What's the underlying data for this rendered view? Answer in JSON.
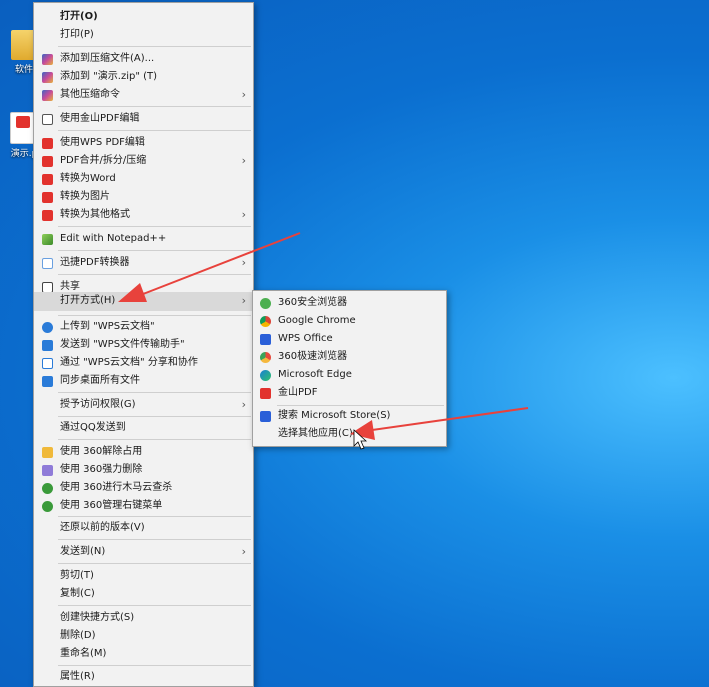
{
  "desktop": {
    "icons": [
      {
        "label": "软件"
      },
      {
        "label": "演示.p"
      }
    ]
  },
  "context_menu": {
    "items": [
      {
        "label": "打开(O)"
      },
      {
        "label": "打印(P)"
      },
      {
        "label": "添加到压缩文件(A)..."
      },
      {
        "label": "添加到 \"演示.zip\" (T)"
      },
      {
        "label": "其他压缩命令"
      },
      {
        "label": "使用金山PDF编辑"
      },
      {
        "label": "使用WPS PDF编辑"
      },
      {
        "label": "PDF合并/拆分/压缩"
      },
      {
        "label": "转换为Word"
      },
      {
        "label": "转换为图片"
      },
      {
        "label": "转换为其他格式"
      },
      {
        "label": "Edit with Notepad++"
      },
      {
        "label": "迅捷PDF转换器"
      },
      {
        "label": "共享"
      },
      {
        "label": "打开方式(H)"
      },
      {
        "label": "上传到 \"WPS云文档\""
      },
      {
        "label": "发送到 \"WPS文件传输助手\""
      },
      {
        "label": "通过 \"WPS云文档\" 分享和协作"
      },
      {
        "label": "同步桌面所有文件"
      },
      {
        "label": "授予访问权限(G)"
      },
      {
        "label": "通过QQ发送到"
      },
      {
        "label": "使用 360解除占用"
      },
      {
        "label": "使用 360强力删除"
      },
      {
        "label": "使用 360进行木马云查杀"
      },
      {
        "label": "使用 360管理右键菜单"
      },
      {
        "label": "还原以前的版本(V)"
      },
      {
        "label": "发送到(N)"
      },
      {
        "label": "剪切(T)"
      },
      {
        "label": "复制(C)"
      },
      {
        "label": "创建快捷方式(S)"
      },
      {
        "label": "删除(D)"
      },
      {
        "label": "重命名(M)"
      },
      {
        "label": "属性(R)"
      }
    ]
  },
  "open_with_submenu": {
    "items": [
      {
        "label": "360安全浏览器"
      },
      {
        "label": "Google Chrome"
      },
      {
        "label": "WPS Office"
      },
      {
        "label": "360极速浏览器"
      },
      {
        "label": "Microsoft Edge"
      },
      {
        "label": "金山PDF"
      },
      {
        "label": "搜索 Microsoft Store(S)"
      },
      {
        "label": "选择其他应用(C)"
      }
    ]
  },
  "colors": {
    "annotation_arrow": "#e8423c",
    "wallpaper": "#0b6fd0"
  }
}
